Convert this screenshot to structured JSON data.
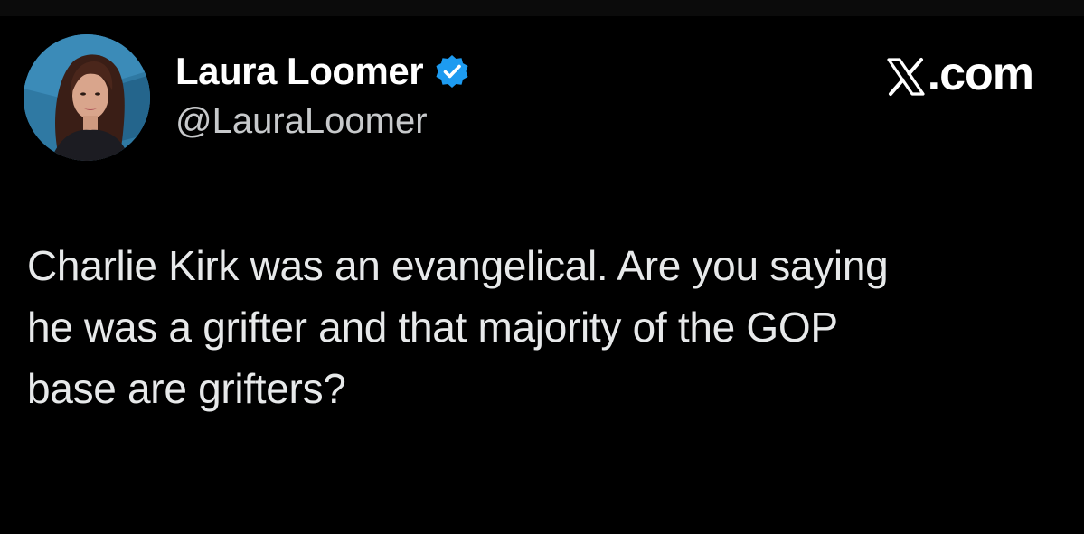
{
  "tweet": {
    "author": {
      "display_name": "Laura Loomer",
      "handle": "@LauraLoomer",
      "verified": true,
      "avatar_icon": "profile-photo-avatar"
    },
    "brand": {
      "logo_icon": "x-logo-icon",
      "text": ".com"
    },
    "body": {
      "lines": [
        "Charlie Kirk was an evangelical. Are you saying",
        "he was a grifter and that majority of the GOP",
        "base are grifters?"
      ]
    }
  },
  "colors": {
    "background": "#000000",
    "text_primary": "#e7e9ea",
    "text_secondary": "#c7c9cb",
    "verified_blue": "#1d9bf0",
    "avatar_bg": "#2a6f96"
  }
}
